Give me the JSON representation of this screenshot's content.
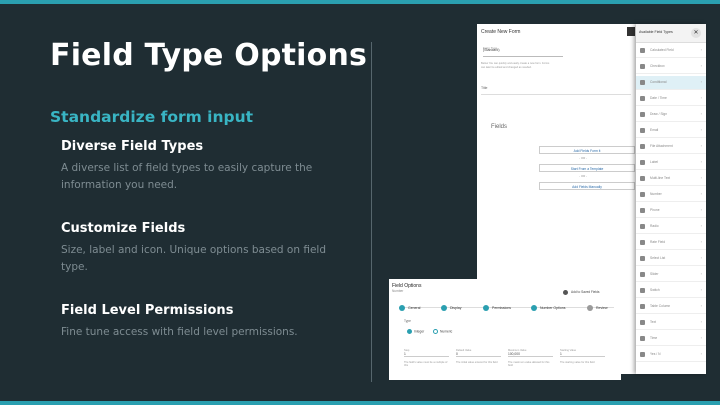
{
  "slide": {
    "title": "Field Type Options",
    "subtitle": "Standardize form input",
    "features": [
      {
        "heading": "Diverse Field Types",
        "desc": "A diverse list of field types to easily capture the information you need."
      },
      {
        "heading": "Customize Fields",
        "desc": "Size, label and icon. Unique options based on field type."
      },
      {
        "heading": "Field Level Permissions",
        "desc": "Fine tune access with field level permissions."
      }
    ]
  },
  "form_builder": {
    "title": "Create New Form",
    "select_label": "Form Type",
    "select_value": "(Standard)",
    "note": "Below You can quickly and easily create a new form. Forms can later be edited and changed as needed.",
    "row_label": "Title",
    "fields_label": "Fields",
    "buttons": [
      "Add Fields Form it",
      "Start From a Template",
      "Add Fields Manually"
    ],
    "or_label": "- OR -"
  },
  "field_types_panel": {
    "title": "Available Field Types",
    "close_glyph": "✕",
    "items": [
      "Calculated Field",
      "Checkbox",
      "Conditional",
      "Date / Time",
      "Draw / Sign",
      "Email",
      "File Attachment",
      "Label",
      "Multi-line Text",
      "Number",
      "Phone",
      "Radio",
      "Rate Field",
      "Select List",
      "Slider",
      "Switch",
      "Table Column",
      "Text",
      "Time",
      "Yes / N"
    ],
    "selected_index": 2,
    "chevron": "›"
  },
  "field_options": {
    "title": "Field Options",
    "subtitle": "Number",
    "add_label": "Add to Saved Fields",
    "steps": [
      "General",
      "Display",
      "Permissions",
      "Number Options",
      "Review"
    ],
    "type_label": "Type",
    "radios": [
      "Integer",
      "Numeric"
    ],
    "fields": [
      {
        "label": "Step",
        "value": "1",
        "hint": "The field's value must be a multiple of this"
      },
      {
        "label": "Default Value",
        "value": "0",
        "hint": "The initial value entered for this field"
      },
      {
        "label": "Maximum Value",
        "value": "100,000",
        "hint": "The maximum value allowed for this field"
      },
      {
        "label": "Starting Value",
        "value": "1",
        "hint": "The starting value for this field"
      }
    ]
  },
  "colors": {
    "accent": "#2a9fb0",
    "background": "#1f2d33"
  }
}
